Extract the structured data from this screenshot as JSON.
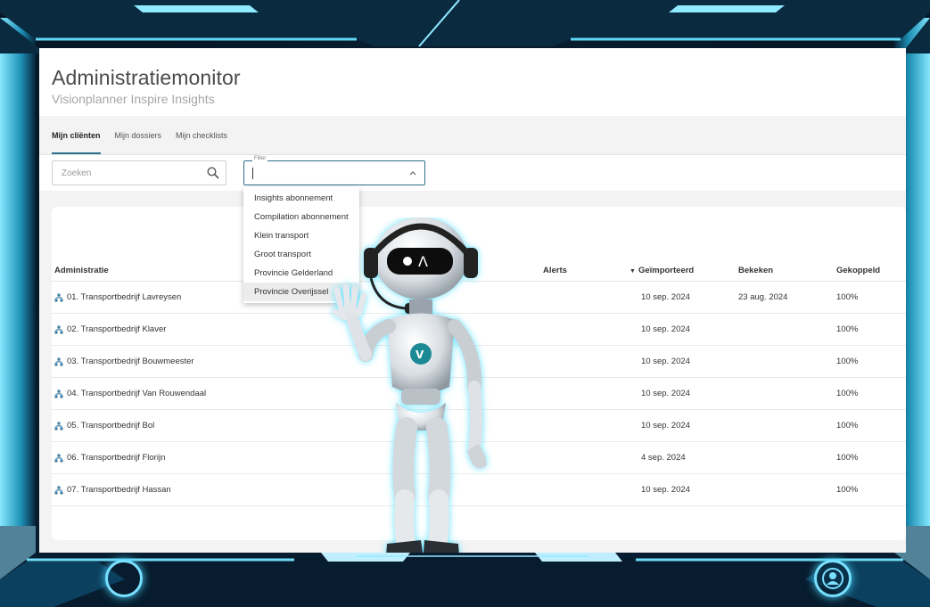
{
  "app": {
    "title": "Administratiemonitor",
    "subtitle": "Visionplanner Inspire Insights"
  },
  "tabs": [
    {
      "label": "Mijn cliënten",
      "active": true
    },
    {
      "label": "Mijn dossiers",
      "active": false
    },
    {
      "label": "Mijn checklists",
      "active": false
    }
  ],
  "search": {
    "placeholder": "Zoeken",
    "value": ""
  },
  "filter": {
    "legend": "Filter",
    "value": "",
    "options": [
      "Insights abonnement",
      "Compilation abonnement",
      "Klein transport",
      "Groot transport",
      "Provincie Gelderland",
      "Provincie Overijssel"
    ],
    "hovered_index": 5
  },
  "table": {
    "columns": {
      "administratie": "Administratie",
      "alerts": "Alerts",
      "geimporteerd": "Geïmporteerd",
      "bekeken": "Bekeken",
      "gekoppeld": "Gekoppeld"
    },
    "sorted_column": "geimporteerd",
    "sort_direction": "desc",
    "rows": [
      {
        "name": "01. Transportbedrijf Lavreysen",
        "geimporteerd": "10 sep. 2024",
        "bekeken": "23 aug. 2024",
        "gekoppeld": "100%"
      },
      {
        "name": "02. Transportbedrijf Klaver",
        "geimporteerd": "10 sep. 2024",
        "bekeken": "",
        "gekoppeld": "100%"
      },
      {
        "name": "03. Transportbedrijf Bouwmeester",
        "geimporteerd": "10 sep. 2024",
        "bekeken": "",
        "gekoppeld": "100%"
      },
      {
        "name": "04. Transportbedrijf Van Rouwendaal",
        "geimporteerd": "10 sep. 2024",
        "bekeken": "",
        "gekoppeld": "100%"
      },
      {
        "name": "05. Transportbedrijf Bol",
        "geimporteerd": "10 sep. 2024",
        "bekeken": "",
        "gekoppeld": "100%"
      },
      {
        "name": "06. Transportbedrijf Florijn",
        "geimporteerd": "4 sep. 2024",
        "bekeken": "",
        "gekoppeld": "100%"
      },
      {
        "name": "07. Transportbedrijf Hassan",
        "geimporteerd": "10 sep. 2024",
        "bekeken": "",
        "gekoppeld": "100%"
      }
    ]
  },
  "icons": {
    "search": "search-icon",
    "chevron": "chevron-up-icon",
    "row": "org-chart-icon",
    "frame_right": "user-icon"
  },
  "colors": {
    "accent": "#2b6f8c",
    "org_icon": "#3a7ca0",
    "frame_glow": "#79e0ff",
    "frame_dark": "#061726"
  },
  "robot": {
    "visor_glyph": "●Λ",
    "chest_glyph": "V"
  }
}
